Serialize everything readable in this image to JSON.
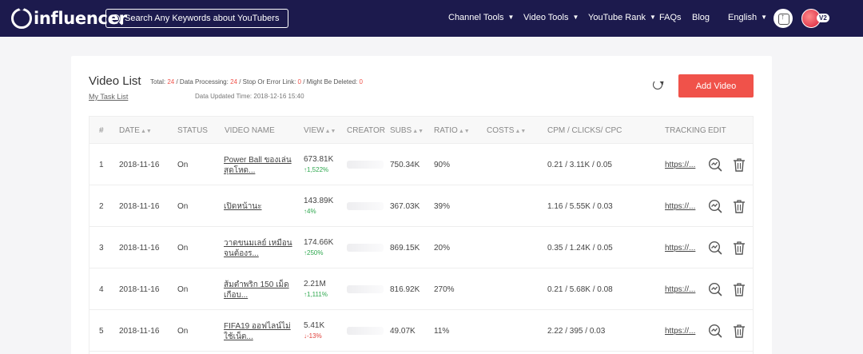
{
  "brand": {
    "logo": "influencer"
  },
  "search": {
    "placeholder": "Search Any Keywords about YouTubers"
  },
  "nav": {
    "channel_tools": "Channel Tools",
    "video_tools": "Video Tools",
    "youtube_rank": "YouTube Rank",
    "faqs": "FAQs",
    "blog": "Blog",
    "language": "English"
  },
  "user": {
    "badge": "V2"
  },
  "page": {
    "title": "Video List",
    "total_label": "Total: ",
    "total_value": "24",
    "processing_label": " / Data Processing: ",
    "processing_value": "24",
    "error_label": " / Stop Or Error Link: ",
    "error_value": "0",
    "deleted_label": " / Might Be Deleted: ",
    "deleted_value": "0",
    "task_list": "My Task List",
    "updated": "Data Updated Time: 2018-12-16 15:40",
    "add_video": "Add Video"
  },
  "columns": {
    "num": "#",
    "date": "DATE",
    "status": "STATUS",
    "video_name": "VIDEO NAME",
    "view": "VIEW",
    "creator": "CREATOR",
    "subs": "SUBS",
    "ratio": "RATIO",
    "costs": "COSTS",
    "cpm": "CPM / CLICKS/ CPC",
    "tracking": "TRACKING",
    "edit": "EDIT"
  },
  "rows": [
    {
      "num": "1",
      "date": "2018-11-16",
      "status": "On",
      "name_1": "Power Ball ของเล่น",
      "name_2": "สุดโหด...",
      "views": "673.81K",
      "change": "↑1,522%",
      "dir": "up",
      "subs": "750.34K",
      "ratio": "90%",
      "cpm": "0.21 / 3.11K / 0.05",
      "tracking": "https://..."
    },
    {
      "num": "2",
      "date": "2018-11-16",
      "status": "On",
      "name_1": "เปิดหน้านะ",
      "name_2": "",
      "views": "143.89K",
      "change": "↑4%",
      "dir": "up",
      "subs": "367.03K",
      "ratio": "39%",
      "cpm": "1.16 / 5.55K / 0.03",
      "tracking": "https://..."
    },
    {
      "num": "3",
      "date": "2018-11-16",
      "status": "On",
      "name_1": "วาดขนมเลย์ เหมือน",
      "name_2": "จนต้องร...",
      "views": "174.66K",
      "change": "↑250%",
      "dir": "up",
      "subs": "869.15K",
      "ratio": "20%",
      "cpm": "0.35 / 1.24K / 0.05",
      "tracking": "https://..."
    },
    {
      "num": "4",
      "date": "2018-11-16",
      "status": "On",
      "name_1": "ส้มตำพริก 150 เม็ด",
      "name_2": "เกือบ...",
      "views": "2.21M",
      "change": "↑1,111%",
      "dir": "up",
      "subs": "816.92K",
      "ratio": "270%",
      "cpm": "0.21 / 5.68K / 0.08",
      "tracking": "https://..."
    },
    {
      "num": "5",
      "date": "2018-11-16",
      "status": "On",
      "name_1": "FIFA19 ออฟไลน์ไม่",
      "name_2": "ใช้เน็ต...",
      "views": "5.41K",
      "change": "↓-13%",
      "dir": "down",
      "subs": "49.07K",
      "ratio": "11%",
      "cpm": "2.22 / 395 / 0.03",
      "tracking": "https://..."
    }
  ]
}
